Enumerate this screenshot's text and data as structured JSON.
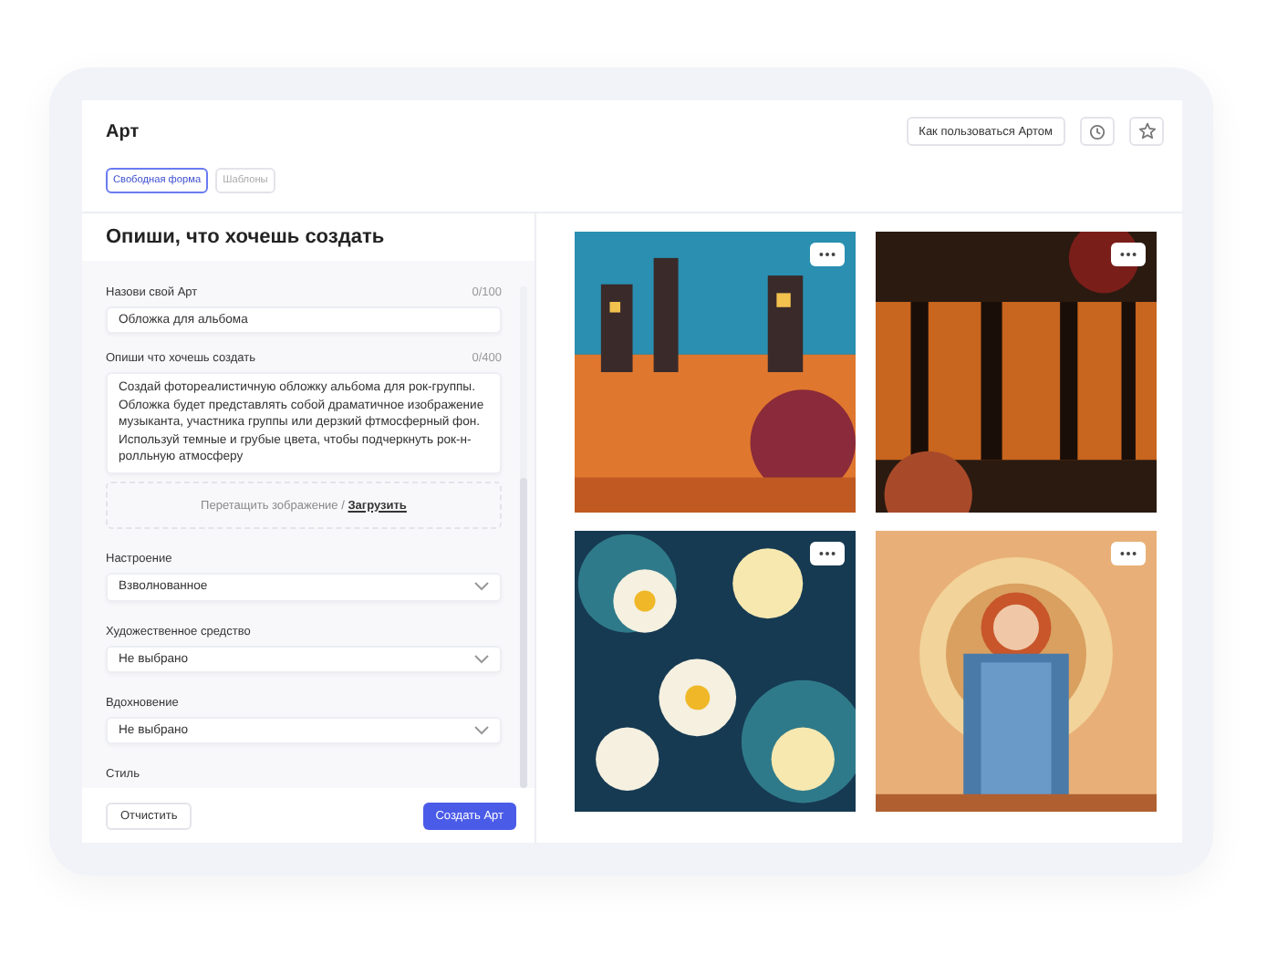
{
  "header": {
    "title": "Арт",
    "tabs": [
      {
        "label": "Свободная форма",
        "selected": true
      },
      {
        "label": "Шаблоны",
        "selected": false
      }
    ],
    "help_button": "Как пользоваться Артом"
  },
  "form": {
    "heading": "Опиши, что хочешь создать",
    "name_field": {
      "label": "Назови свой Арт",
      "counter": "0/100",
      "value": "Обложка для альбома"
    },
    "description_field": {
      "label": "Опиши что хочешь создать",
      "counter": "0/400",
      "value": "Создай фотореалистичную обложку альбома для рок-группы. Обложка будет представлять собой драматичное изображение музыканта, участника группы или дерзкий фтмосферный фон. Используй темные и грубые цвета, чтобы подчеркнуть рок-н-ролльную атмосферу"
    },
    "upload": {
      "text": "Перетащить зображение / ",
      "link": "Загрузить"
    },
    "selects": [
      {
        "label": "Настроение",
        "value": "Взволнованное"
      },
      {
        "label": "Художественное средство",
        "value": "Не выбрано"
      },
      {
        "label": "Вдохновение",
        "value": "Не выбрано"
      }
    ],
    "style_label": "Стиль"
  },
  "footer": {
    "clear_button": "Отчистить",
    "create_button": "Создать Арт"
  }
}
